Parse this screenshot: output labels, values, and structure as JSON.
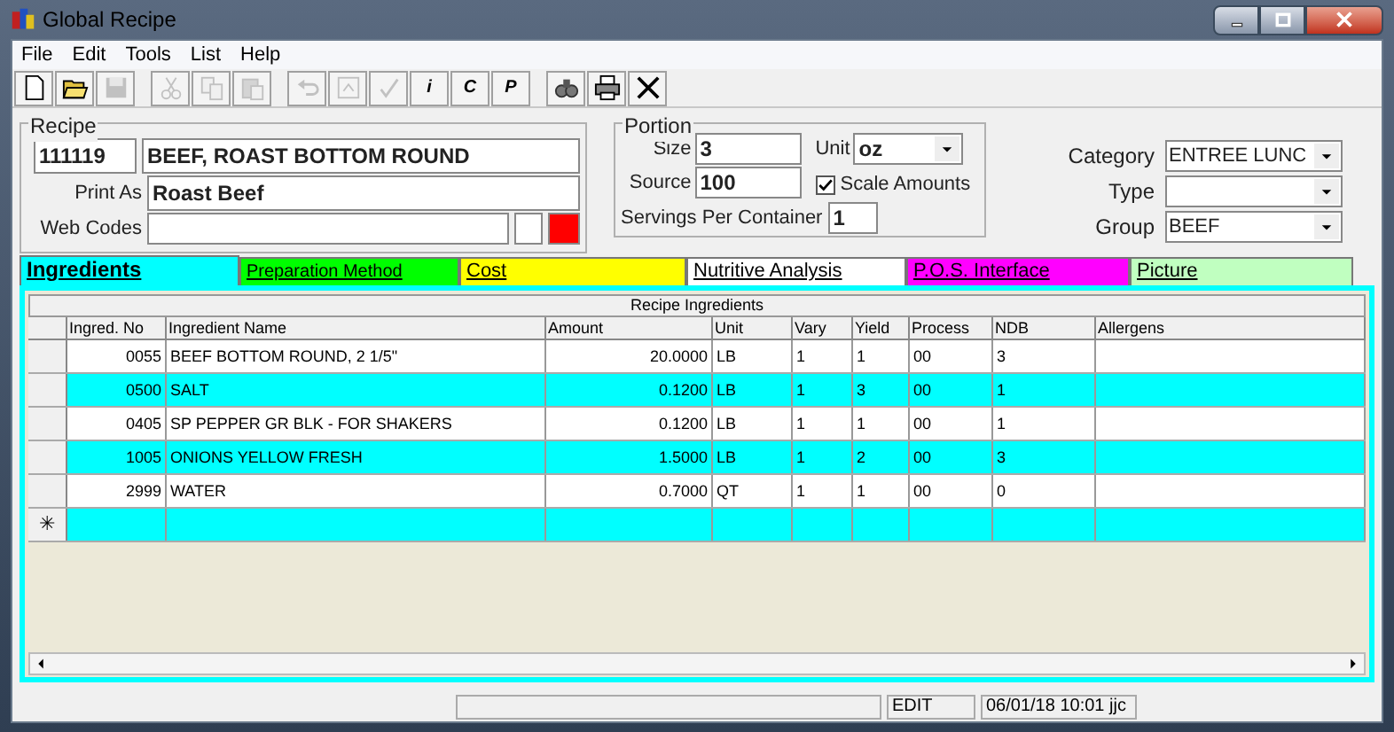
{
  "window": {
    "title": "Global Recipe"
  },
  "menu": [
    "File",
    "Edit",
    "Tools",
    "List",
    "Help"
  ],
  "toolbar": [
    {
      "kind": "new",
      "disabled": false
    },
    {
      "kind": "open",
      "disabled": false
    },
    {
      "kind": "save",
      "disabled": true
    },
    {
      "kind": "cut",
      "disabled": true
    },
    {
      "kind": "copy",
      "disabled": true
    },
    {
      "kind": "paste",
      "disabled": true
    },
    {
      "kind": "undo",
      "disabled": true
    },
    {
      "kind": "refresh",
      "disabled": true
    },
    {
      "kind": "spell",
      "disabled": true
    },
    {
      "kind": "letter",
      "label": "i",
      "disabled": false
    },
    {
      "kind": "letter",
      "label": "C",
      "disabled": false
    },
    {
      "kind": "letter",
      "label": "P",
      "disabled": false
    },
    {
      "kind": "find",
      "disabled": false
    },
    {
      "kind": "print",
      "disabled": false
    },
    {
      "kind": "close",
      "disabled": false
    }
  ],
  "recipe": {
    "legend": "Recipe",
    "number": "111119",
    "name": "BEEF, ROAST BOTTOM ROUND",
    "print_as_label": "Print As",
    "print_as": "Roast Beef",
    "web_codes_label": "Web Codes",
    "color": "#ff0000"
  },
  "portion": {
    "legend": "Portion",
    "size_label": "Size",
    "size": "3",
    "source_label": "Source",
    "source": "100",
    "unit_label": "Unit",
    "unit": "oz",
    "scale_label": "Scale Amounts",
    "scale_checked": true,
    "servings_label": "Servings Per Container",
    "servings": "1"
  },
  "classification": [
    {
      "label": "Category",
      "value": "ENTREE LUNC"
    },
    {
      "label": "Type"
    },
    {
      "label": "Group",
      "value": "BEEF"
    }
  ],
  "tabs": [
    {
      "label": "Ingredients",
      "selected": true,
      "color": "#00ffff"
    },
    {
      "label": "Preparation Method",
      "selected": false,
      "color": "#00ff00"
    },
    {
      "label": "Cost",
      "selected": false,
      "color": "#ffff00"
    },
    {
      "label": "Nutritive Analysis",
      "selected": false,
      "color": "#ffffff"
    },
    {
      "label": "P.O.S. Interface",
      "selected": false,
      "color": "#ff00ff"
    },
    {
      "label": "Picture",
      "selected": false,
      "color": "#c0ffc0"
    }
  ],
  "table": {
    "title": "Recipe Ingredients",
    "columns": [
      "Ingred. No",
      "Ingredient Name",
      "Amount",
      "Unit",
      "Vary",
      "Yield",
      "Process",
      "NDB",
      "Allergens"
    ],
    "rows": [
      [
        "0055",
        "BEEF BOTTOM ROUND, 2 1/5\"",
        "20.0000",
        "LB",
        "1",
        "1",
        "00",
        "3",
        ""
      ],
      [
        "0500",
        "SALT",
        "0.1200",
        "LB",
        "1",
        "3",
        "00",
        "1",
        ""
      ],
      [
        "0405",
        "SP PEPPER GR BLK - FOR SHAKERS",
        "0.1200",
        "LB",
        "1",
        "1",
        "00",
        "1",
        ""
      ],
      [
        "1005",
        "ONIONS YELLOW FRESH",
        "1.5000",
        "LB",
        "1",
        "2",
        "00",
        "3",
        ""
      ],
      [
        "2999",
        "WATER",
        "0.7000",
        "QT",
        "1",
        "1",
        "00",
        "0",
        ""
      ]
    ],
    "new_row_marker": "✳"
  },
  "status_bar": [
    "EDIT",
    "06/01/18 10:01 jjc"
  ]
}
